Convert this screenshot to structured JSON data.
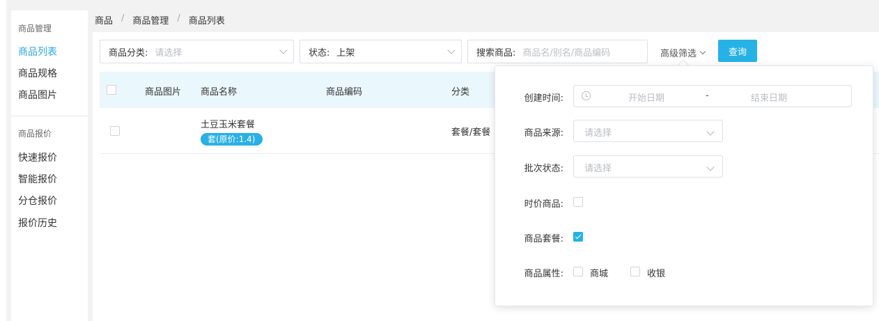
{
  "sidebar": {
    "group1_title": "商品管理",
    "group1_items": [
      "商品列表",
      "商品规格",
      "商品图片"
    ],
    "group2_title": "商品报价",
    "group2_items": [
      "快速报价",
      "智能报价",
      "分仓报价",
      "报价历史"
    ],
    "active_item": "商品列表"
  },
  "breadcrumb": [
    "商品",
    "商品管理",
    "商品列表"
  ],
  "breadcrumb_separator": "/",
  "filters": {
    "category_label": "商品分类:",
    "category_placeholder": "请选择",
    "status_label": "状态:",
    "status_value": "上架",
    "search_label": "搜索商品:",
    "search_placeholder": "商品名/别名/商品编码",
    "advanced_label": "高级筛选",
    "query_button": "查询"
  },
  "table": {
    "headers": [
      "商品图片",
      "商品名称",
      "商品编码",
      "分类"
    ],
    "rows": [
      {
        "name": "土豆玉米套餐",
        "tag": "套(原价:1.4)",
        "code": "",
        "category": "套餐/套餐"
      }
    ]
  },
  "advanced_panel": {
    "created_time_label": "创建时间:",
    "start_date_placeholder": "开始日期",
    "date_separator": "-",
    "end_date_placeholder": "结束日期",
    "source_label": "商品来源:",
    "source_placeholder": "请选择",
    "batch_status_label": "批次状态:",
    "batch_status_placeholder": "请选择",
    "time_price_label": "时价商品:",
    "time_price_checked": false,
    "combo_label": "商品套餐:",
    "combo_checked": true,
    "attribute_label": "商品属性:",
    "attribute_options": [
      "商城",
      "收银"
    ]
  },
  "colors": {
    "accent": "#27b2e6",
    "header_bg": "#eaf7fc",
    "page_bg": "#f2f2f2"
  }
}
